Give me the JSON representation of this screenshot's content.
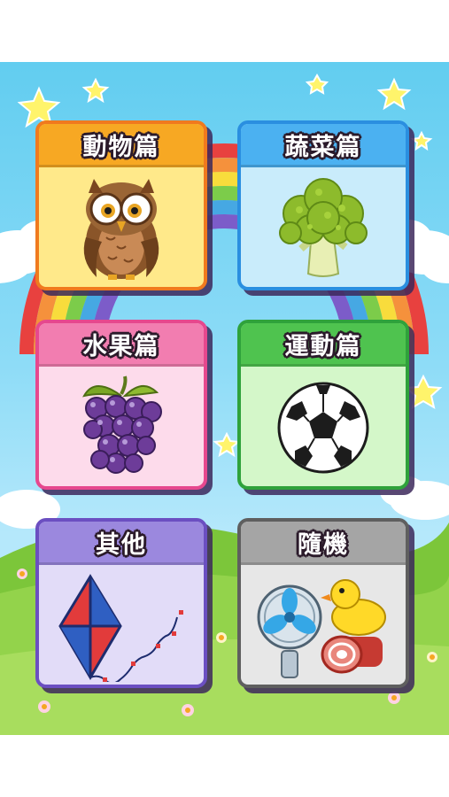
{
  "categories": [
    {
      "title": "動物篇",
      "icon": "owl-icon",
      "colors": {
        "border": "#f07a1e",
        "head": "#f7a823",
        "body": "#ffe98a"
      }
    },
    {
      "title": "蔬菜篇",
      "icon": "broccoli-icon",
      "colors": {
        "border": "#2a8fe0",
        "head": "#4bb1f1",
        "body": "#c9ecfb"
      }
    },
    {
      "title": "水果篇",
      "icon": "grapes-icon",
      "colors": {
        "border": "#e6488e",
        "head": "#f27db0",
        "body": "#fddbeb"
      }
    },
    {
      "title": "運動篇",
      "icon": "soccer-ball-icon",
      "colors": {
        "border": "#2fa23b",
        "head": "#4fc34f",
        "body": "#d4f7c9"
      }
    },
    {
      "title": "其他",
      "icon": "kite-icon",
      "colors": {
        "border": "#6b4fc1",
        "head": "#9b88de",
        "body": "#e2dcf8"
      }
    },
    {
      "title": "隨機",
      "icon": "random-items-icon",
      "colors": {
        "border": "#5f5f5f",
        "head": "#a5a5a5",
        "body": "#e7e7e7"
      }
    }
  ]
}
